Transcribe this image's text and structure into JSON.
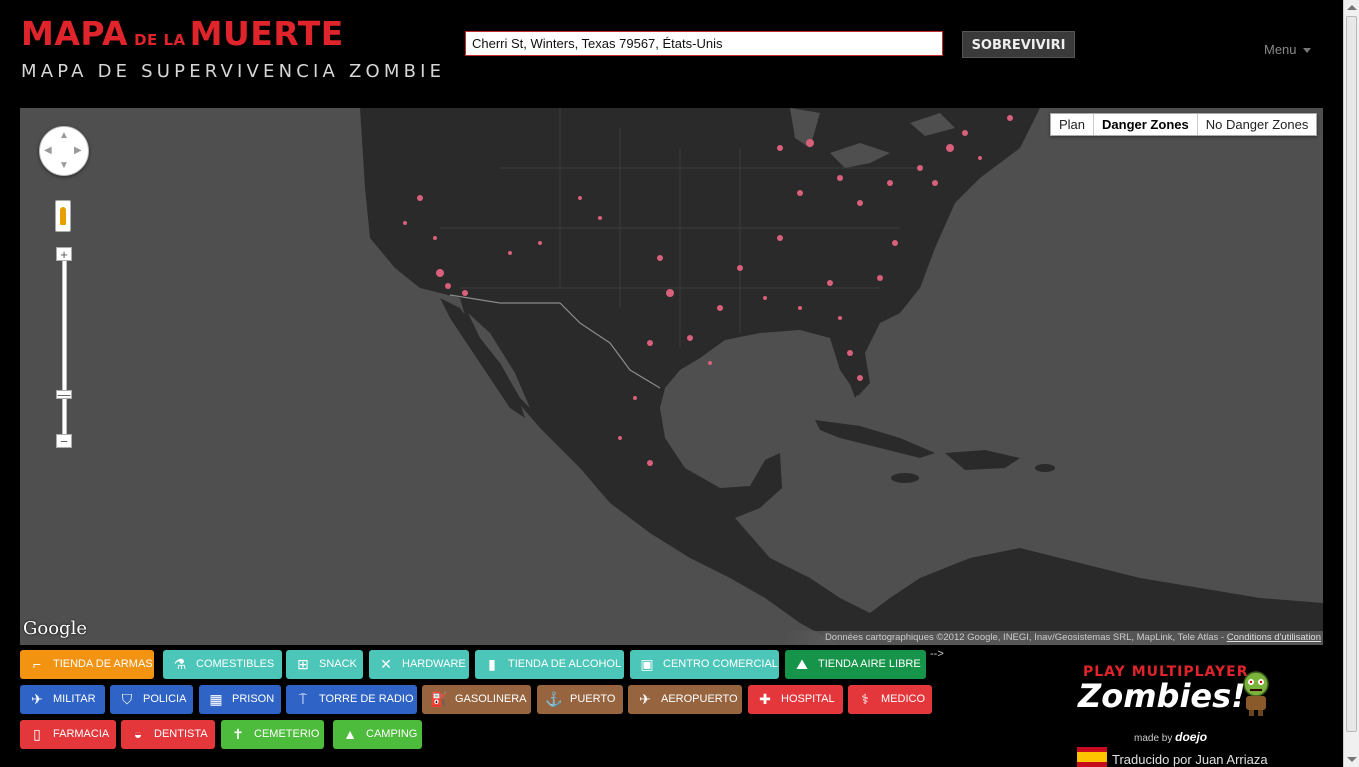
{
  "header": {
    "title_part1": "MAPA",
    "title_part2": "DE LA",
    "title_part3": "MUERTE",
    "subtitle": "MAPA DE SUPERVIVENCIA ZOMBIE",
    "search_value": "Cherri St, Winters, Texas 79567, États-Unis",
    "search_button": "SOBREVIVIRI",
    "menu_label": "Menu"
  },
  "map": {
    "map_types": [
      "Plan",
      "Danger Zones",
      "No Danger Zones"
    ],
    "active_type": "Danger Zones",
    "zoom_in": "+",
    "zoom_out": "−",
    "logo": "Google",
    "attribution": "Données cartographiques ©2012 Google, INEGI, Inav/Geosistemas SRL, MapLink, Tele Atlas - ",
    "terms_link": "Conditions d'utilisation",
    "colors": {
      "land": "#2a2a2a",
      "water": "#4f4f4f",
      "hotspot": "#d9607a"
    }
  },
  "categories": [
    {
      "label": "TIENDA DE ARMAS",
      "icon": "gun-icon",
      "color": "#f29312"
    },
    {
      "label": "COMESTIBLES",
      "icon": "groceries-icon",
      "color": "#4cc6b9"
    },
    {
      "label": "SNACK",
      "icon": "basket-icon",
      "color": "#4cc6b9"
    },
    {
      "label": "HARDWARE",
      "icon": "tools-icon",
      "color": "#4cc6b9"
    },
    {
      "label": "TIENDA DE ALCOHOL",
      "icon": "bottle-icon",
      "color": "#4cc6b9"
    },
    {
      "label": "CENTRO COMERCIAL",
      "icon": "shopping-bag-icon",
      "color": "#4cc6b9"
    },
    {
      "label": "TIENDA AIRE LIBRE",
      "icon": "mountain-icon",
      "color": "#16944a"
    },
    {
      "label": "MILITAR",
      "icon": "helicopter-icon",
      "color": "#2f63c6"
    },
    {
      "label": "POLICIA",
      "icon": "shield-icon",
      "color": "#2f63c6"
    },
    {
      "label": "PRISON",
      "icon": "prison-icon",
      "color": "#2f63c6"
    },
    {
      "label": "TORRE DE RADIO",
      "icon": "radio-tower-icon",
      "color": "#2f63c6"
    },
    {
      "label": "GASOLINERA",
      "icon": "fuel-icon",
      "color": "#96643f"
    },
    {
      "label": "PUERTO",
      "icon": "anchor-icon",
      "color": "#96643f"
    },
    {
      "label": "AEROPUERTO",
      "icon": "airplane-icon",
      "color": "#96643f"
    },
    {
      "label": "HOSPITAL",
      "icon": "hospital-icon",
      "color": "#e4373c"
    },
    {
      "label": "MEDICO",
      "icon": "caduceus-icon",
      "color": "#e4373c"
    },
    {
      "label": "FARMACIA",
      "icon": "pill-bottle-icon",
      "color": "#e4373c"
    },
    {
      "label": "DENTISTA",
      "icon": "tooth-icon",
      "color": "#e4373c"
    },
    {
      "label": "CEMETERIO",
      "icon": "cemetery-icon",
      "color": "#4dbb3b"
    },
    {
      "label": "CAMPING",
      "icon": "tent-icon",
      "color": "#4dbb3b"
    }
  ],
  "arrow_text": "-->",
  "promo": {
    "line1": "PLAY MULTIPLAYER",
    "line2": "Zombies!",
    "made_by": "made by",
    "brand": "doejo"
  },
  "translator": "Traducido por Juan Arriaza"
}
